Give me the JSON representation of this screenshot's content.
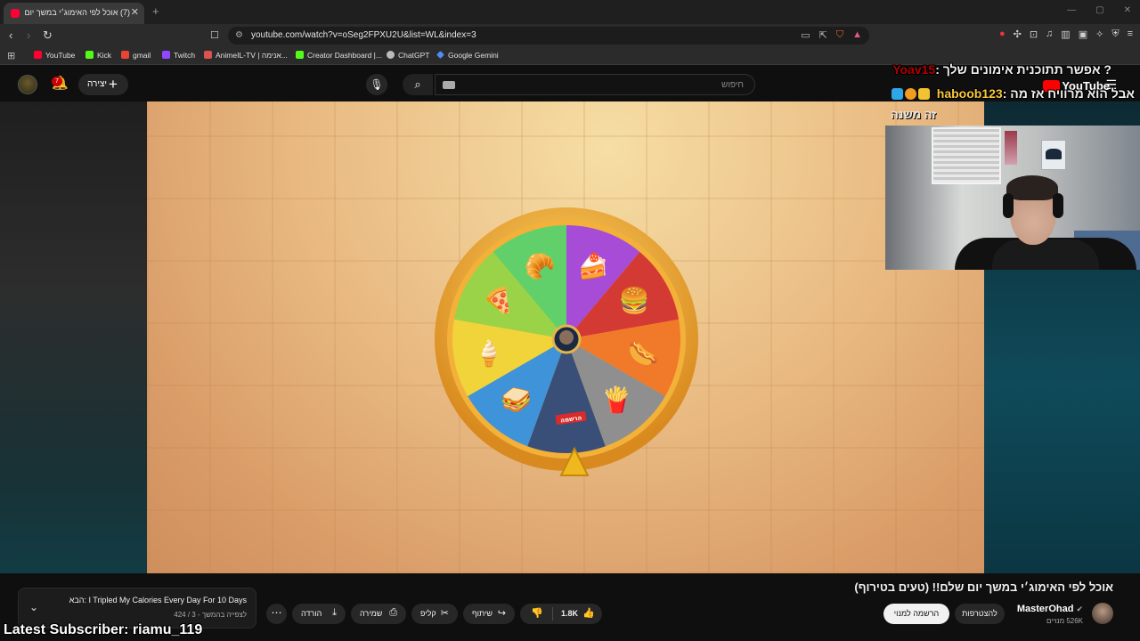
{
  "browser": {
    "tab_title": "(7) אוכל לפי האימוג׳י במשך יום ש",
    "url": "youtube.com/watch?v=oSeg2FPXU2U&list=WL&index=3",
    "bookmarks": [
      {
        "label": "YouTube",
        "color": "#ff0033"
      },
      {
        "label": "Kick",
        "color": "#53fc18"
      },
      {
        "label": "gmail",
        "color": "#ea4335"
      },
      {
        "label": "Twitch",
        "color": "#9146ff"
      },
      {
        "label": "AnimeIL-TV | אנימה...",
        "color": "#d9534f"
      },
      {
        "label": "Creator Dashboard |...",
        "color": "#53fc18"
      },
      {
        "label": "ChatGPT",
        "color": "#bbbbbb"
      },
      {
        "label": "Google Gemini",
        "color": "#4f8cf5"
      }
    ]
  },
  "header": {
    "create_label": "יצירה",
    "notification_count": "7",
    "search_placeholder": "חיפוש"
  },
  "overlay": {
    "chat1_user": "Yoav15",
    "chat1_msg": "? אפשר תתוכנית אימונים שלך :",
    "chat2_user": "haboob123",
    "chat2_msg": "אבל הוא מרוויח אז מה :",
    "chat3_msg": "זה משנה",
    "youtube_logo": "YouTube",
    "latest_subscriber": "Latest Subscriber: riamu_119"
  },
  "wheel": {
    "center_label": "הרשמה",
    "segments": [
      {
        "emoji": "🥐",
        "color": "#62d06a"
      },
      {
        "emoji": "🍰",
        "color": "#a64cd6"
      },
      {
        "emoji": "🍔",
        "color": "#d43a34"
      },
      {
        "emoji": "🌭",
        "color": "#f07a29"
      },
      {
        "emoji": "🍟",
        "color": "#8f8f8f"
      },
      {
        "emoji": "",
        "color": "#3a4f78"
      },
      {
        "emoji": "🥪",
        "color": "#3f93d8"
      },
      {
        "emoji": "🍦",
        "color": "#f0d43a"
      },
      {
        "emoji": "🍕",
        "color": "#9ad348"
      }
    ]
  },
  "video": {
    "title": "אוכל לפי האימוג׳י במשך יום שלם!! (טעים בטירוף)",
    "channel": "MasterOhad",
    "subscribers": "526K מנויים",
    "join_label": "להצטרפות",
    "subscribe_label": "הרשמה למנוי",
    "like_count": "1.8K",
    "share_label": "שיתוף",
    "clip_label": "קליפ",
    "save_label": "שמירה",
    "download_label": "הורדה"
  },
  "up_next": {
    "title": "הבא: I Tripled My Calories Every Day For 10 Days",
    "subtitle": "לצפייה בהמשך - 3 / 424"
  }
}
